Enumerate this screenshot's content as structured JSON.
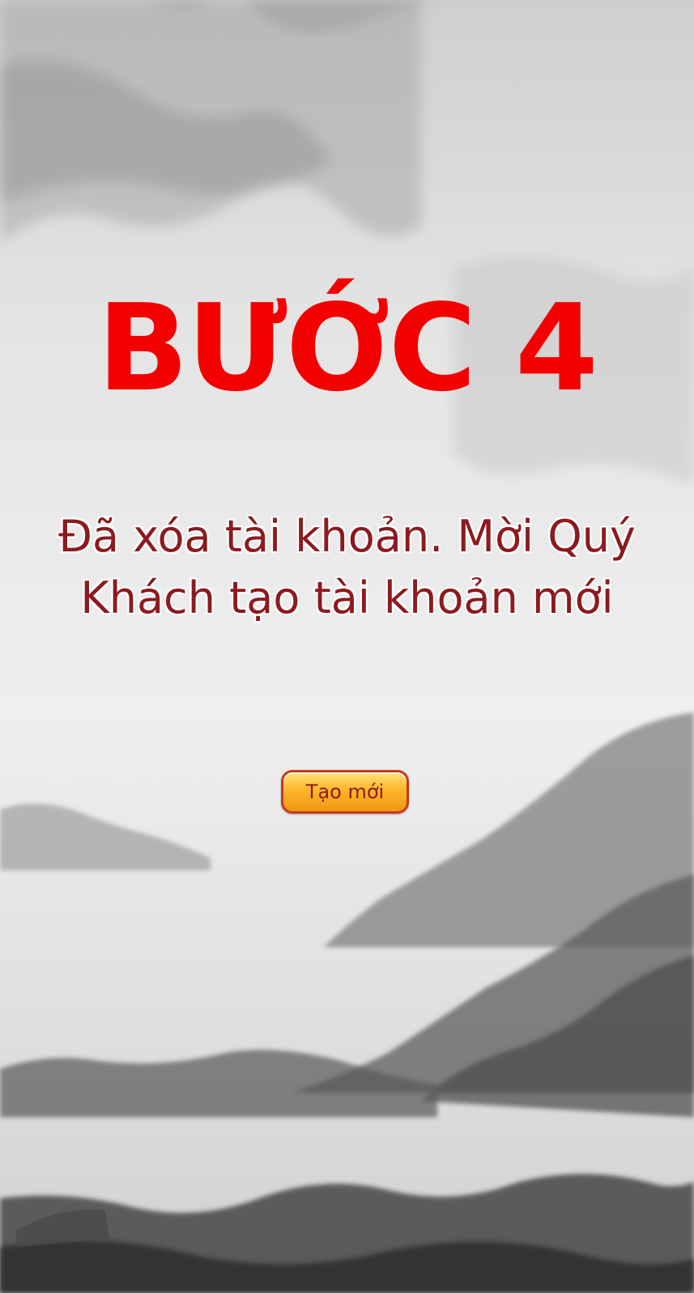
{
  "step": {
    "title": "BƯỚC 4"
  },
  "message": {
    "text": "Đã xóa tài khoản. Mời Quý Khách tạo tài khoản mới"
  },
  "actions": {
    "create_label": "Tạo mới"
  },
  "colors": {
    "title": "#f50000",
    "message": "#8c1a1e",
    "button_gold": "#ffb62b"
  },
  "background": {
    "icon": "ink-landscape-painting"
  }
}
